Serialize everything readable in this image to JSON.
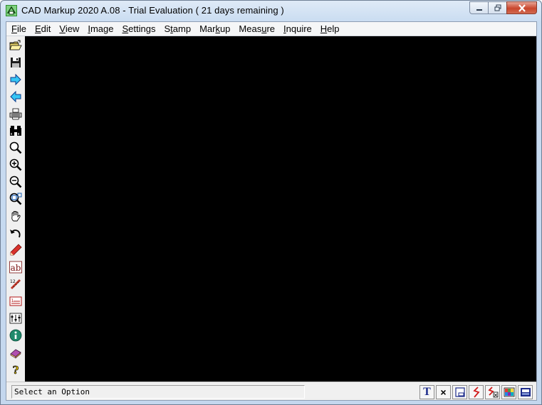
{
  "window": {
    "title": "CAD Markup 2020 A.08 - Trial Evaluation ( 21 days remaining )"
  },
  "menu": [
    {
      "pre": "",
      "key": "F",
      "post": "ile"
    },
    {
      "pre": "",
      "key": "E",
      "post": "dit"
    },
    {
      "pre": "",
      "key": "V",
      "post": "iew"
    },
    {
      "pre": "",
      "key": "I",
      "post": "mage"
    },
    {
      "pre": "",
      "key": "S",
      "post": "ettings"
    },
    {
      "pre": "S",
      "key": "t",
      "post": "amp"
    },
    {
      "pre": "Mar",
      "key": "k",
      "post": "up"
    },
    {
      "pre": "Meas",
      "key": "u",
      "post": "re"
    },
    {
      "pre": "",
      "key": "I",
      "post": "nquire"
    },
    {
      "pre": "",
      "key": "H",
      "post": "elp"
    }
  ],
  "toolbar_left": [
    "open-folder-icon",
    "save-icon",
    "next-page-icon",
    "previous-page-icon",
    "print-icon",
    "binoculars-icon",
    "zoom-icon",
    "zoom-in-icon",
    "zoom-out-icon",
    "zoom-window-icon",
    "pan-hand-icon",
    "undo-icon",
    "pencil-icon",
    "text-ab-icon",
    "dimension-icon",
    "list-icon",
    "layers-icon",
    "info-icon",
    "book-icon",
    "help-icon"
  ],
  "statusbar": {
    "message": "Select an Option"
  },
  "status_tools": [
    {
      "icon": "text-tool-icon",
      "glyph": "T"
    },
    {
      "icon": "close-x-icon",
      "glyph": "×"
    },
    {
      "icon": "window-icon",
      "glyph": ""
    },
    {
      "icon": "red-squiggle-icon",
      "glyph": ""
    },
    {
      "icon": "red-squiggle-alt-icon",
      "glyph": ""
    },
    {
      "icon": "color-palette-icon",
      "glyph": ""
    },
    {
      "icon": "printer-status-icon",
      "glyph": ""
    }
  ],
  "colors": {
    "canvas": "#000000",
    "title_gradient_top": "#dfeaf7",
    "close_button": "#c9462d",
    "accent_blue": "#1a5fb4"
  }
}
